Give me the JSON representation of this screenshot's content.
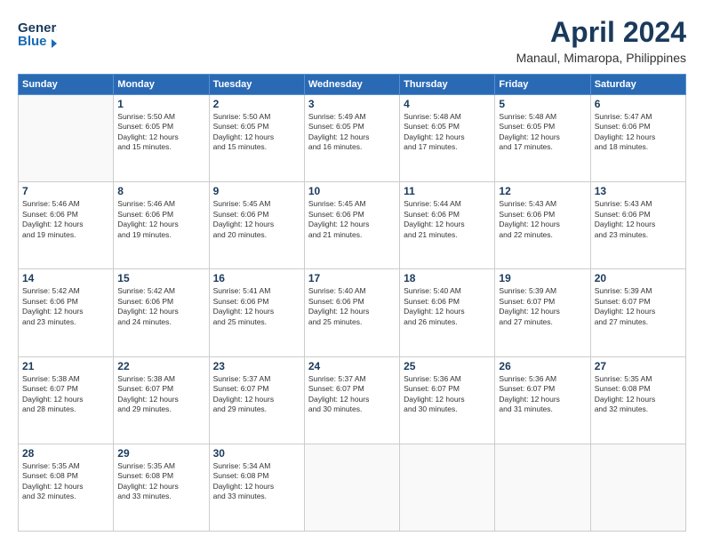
{
  "header": {
    "logo_general": "General",
    "logo_blue": "Blue",
    "title": "April 2024",
    "subtitle": "Manaul, Mimaropa, Philippines"
  },
  "days_of_week": [
    "Sunday",
    "Monday",
    "Tuesday",
    "Wednesday",
    "Thursday",
    "Friday",
    "Saturday"
  ],
  "weeks": [
    [
      {
        "day": "",
        "info": ""
      },
      {
        "day": "1",
        "info": "Sunrise: 5:50 AM\nSunset: 6:05 PM\nDaylight: 12 hours\nand 15 minutes."
      },
      {
        "day": "2",
        "info": "Sunrise: 5:50 AM\nSunset: 6:05 PM\nDaylight: 12 hours\nand 15 minutes."
      },
      {
        "day": "3",
        "info": "Sunrise: 5:49 AM\nSunset: 6:05 PM\nDaylight: 12 hours\nand 16 minutes."
      },
      {
        "day": "4",
        "info": "Sunrise: 5:48 AM\nSunset: 6:05 PM\nDaylight: 12 hours\nand 17 minutes."
      },
      {
        "day": "5",
        "info": "Sunrise: 5:48 AM\nSunset: 6:05 PM\nDaylight: 12 hours\nand 17 minutes."
      },
      {
        "day": "6",
        "info": "Sunrise: 5:47 AM\nSunset: 6:06 PM\nDaylight: 12 hours\nand 18 minutes."
      }
    ],
    [
      {
        "day": "7",
        "info": "Sunrise: 5:46 AM\nSunset: 6:06 PM\nDaylight: 12 hours\nand 19 minutes."
      },
      {
        "day": "8",
        "info": "Sunrise: 5:46 AM\nSunset: 6:06 PM\nDaylight: 12 hours\nand 19 minutes."
      },
      {
        "day": "9",
        "info": "Sunrise: 5:45 AM\nSunset: 6:06 PM\nDaylight: 12 hours\nand 20 minutes."
      },
      {
        "day": "10",
        "info": "Sunrise: 5:45 AM\nSunset: 6:06 PM\nDaylight: 12 hours\nand 21 minutes."
      },
      {
        "day": "11",
        "info": "Sunrise: 5:44 AM\nSunset: 6:06 PM\nDaylight: 12 hours\nand 21 minutes."
      },
      {
        "day": "12",
        "info": "Sunrise: 5:43 AM\nSunset: 6:06 PM\nDaylight: 12 hours\nand 22 minutes."
      },
      {
        "day": "13",
        "info": "Sunrise: 5:43 AM\nSunset: 6:06 PM\nDaylight: 12 hours\nand 23 minutes."
      }
    ],
    [
      {
        "day": "14",
        "info": "Sunrise: 5:42 AM\nSunset: 6:06 PM\nDaylight: 12 hours\nand 23 minutes."
      },
      {
        "day": "15",
        "info": "Sunrise: 5:42 AM\nSunset: 6:06 PM\nDaylight: 12 hours\nand 24 minutes."
      },
      {
        "day": "16",
        "info": "Sunrise: 5:41 AM\nSunset: 6:06 PM\nDaylight: 12 hours\nand 25 minutes."
      },
      {
        "day": "17",
        "info": "Sunrise: 5:40 AM\nSunset: 6:06 PM\nDaylight: 12 hours\nand 25 minutes."
      },
      {
        "day": "18",
        "info": "Sunrise: 5:40 AM\nSunset: 6:06 PM\nDaylight: 12 hours\nand 26 minutes."
      },
      {
        "day": "19",
        "info": "Sunrise: 5:39 AM\nSunset: 6:07 PM\nDaylight: 12 hours\nand 27 minutes."
      },
      {
        "day": "20",
        "info": "Sunrise: 5:39 AM\nSunset: 6:07 PM\nDaylight: 12 hours\nand 27 minutes."
      }
    ],
    [
      {
        "day": "21",
        "info": "Sunrise: 5:38 AM\nSunset: 6:07 PM\nDaylight: 12 hours\nand 28 minutes."
      },
      {
        "day": "22",
        "info": "Sunrise: 5:38 AM\nSunset: 6:07 PM\nDaylight: 12 hours\nand 29 minutes."
      },
      {
        "day": "23",
        "info": "Sunrise: 5:37 AM\nSunset: 6:07 PM\nDaylight: 12 hours\nand 29 minutes."
      },
      {
        "day": "24",
        "info": "Sunrise: 5:37 AM\nSunset: 6:07 PM\nDaylight: 12 hours\nand 30 minutes."
      },
      {
        "day": "25",
        "info": "Sunrise: 5:36 AM\nSunset: 6:07 PM\nDaylight: 12 hours\nand 30 minutes."
      },
      {
        "day": "26",
        "info": "Sunrise: 5:36 AM\nSunset: 6:07 PM\nDaylight: 12 hours\nand 31 minutes."
      },
      {
        "day": "27",
        "info": "Sunrise: 5:35 AM\nSunset: 6:08 PM\nDaylight: 12 hours\nand 32 minutes."
      }
    ],
    [
      {
        "day": "28",
        "info": "Sunrise: 5:35 AM\nSunset: 6:08 PM\nDaylight: 12 hours\nand 32 minutes."
      },
      {
        "day": "29",
        "info": "Sunrise: 5:35 AM\nSunset: 6:08 PM\nDaylight: 12 hours\nand 33 minutes."
      },
      {
        "day": "30",
        "info": "Sunrise: 5:34 AM\nSunset: 6:08 PM\nDaylight: 12 hours\nand 33 minutes."
      },
      {
        "day": "",
        "info": ""
      },
      {
        "day": "",
        "info": ""
      },
      {
        "day": "",
        "info": ""
      },
      {
        "day": "",
        "info": ""
      }
    ]
  ]
}
